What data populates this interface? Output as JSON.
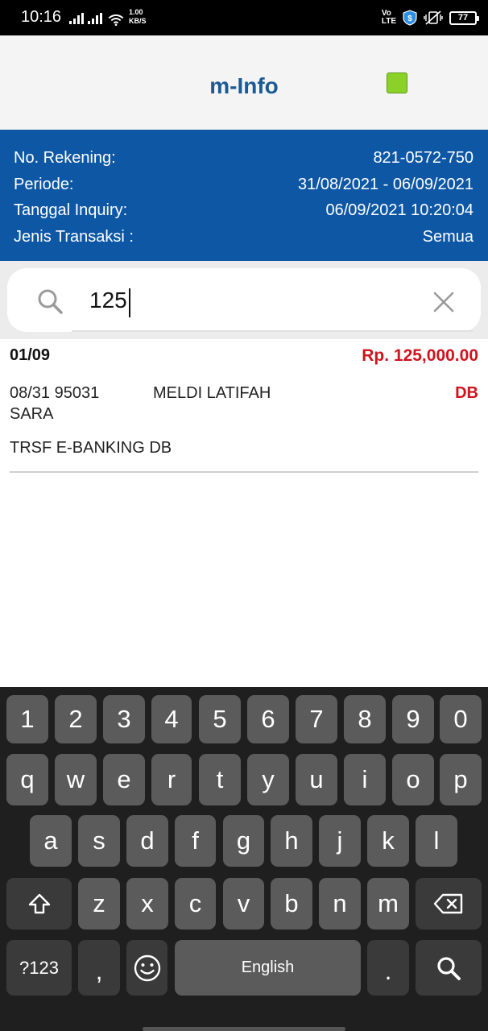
{
  "status_bar": {
    "time": "10:16",
    "speed_value": "1.00",
    "speed_unit": "KB/S",
    "volte": "Vo",
    "lte": "LTE",
    "battery": "77",
    "icons": [
      "signal-icon",
      "signal-icon",
      "wifi-icon",
      "volte-icon",
      "shield-icon",
      "vibrate-icon",
      "battery-icon"
    ]
  },
  "app": {
    "title": "m-Info",
    "status_color": "#8bd12a"
  },
  "info": {
    "rows": [
      {
        "label": "No. Rekening:",
        "value": "821-0572-750"
      },
      {
        "label": "Periode:",
        "value": "31/08/2021 - 06/09/2021"
      },
      {
        "label": "Tanggal Inquiry:",
        "value": "06/09/2021 10:20:04"
      },
      {
        "label": "Jenis Transaksi :",
        "value": "Semua"
      }
    ],
    "background": "#0d57a5"
  },
  "search": {
    "value": "125",
    "icon": "search-icon",
    "clear_icon": "close-icon"
  },
  "transactions": [
    {
      "date": "01/09",
      "amount": "Rp. 125,000.00",
      "ref": "08/31 95031",
      "name_line1": "MELDI LATIFAH",
      "name_line2": "SARA",
      "type": "DB",
      "description": "TRSF E-BANKING DB"
    }
  ],
  "keyboard": {
    "row_numbers": [
      "1",
      "2",
      "3",
      "4",
      "5",
      "6",
      "7",
      "8",
      "9",
      "0"
    ],
    "row_top": [
      "q",
      "w",
      "e",
      "r",
      "t",
      "y",
      "u",
      "i",
      "o",
      "p"
    ],
    "row_mid": [
      "a",
      "s",
      "d",
      "f",
      "g",
      "h",
      "j",
      "k",
      "l"
    ],
    "row_bottom": [
      "z",
      "x",
      "c",
      "v",
      "b",
      "n",
      "m"
    ],
    "symbols_label": "?123",
    "comma": ",",
    "space_label": "English",
    "period": ".",
    "icons": [
      "shift-icon",
      "backspace-icon",
      "emoji-icon",
      "search-icon"
    ]
  },
  "colors": {
    "accent_red": "#d0131e",
    "title_blue": "#1a5a96"
  }
}
